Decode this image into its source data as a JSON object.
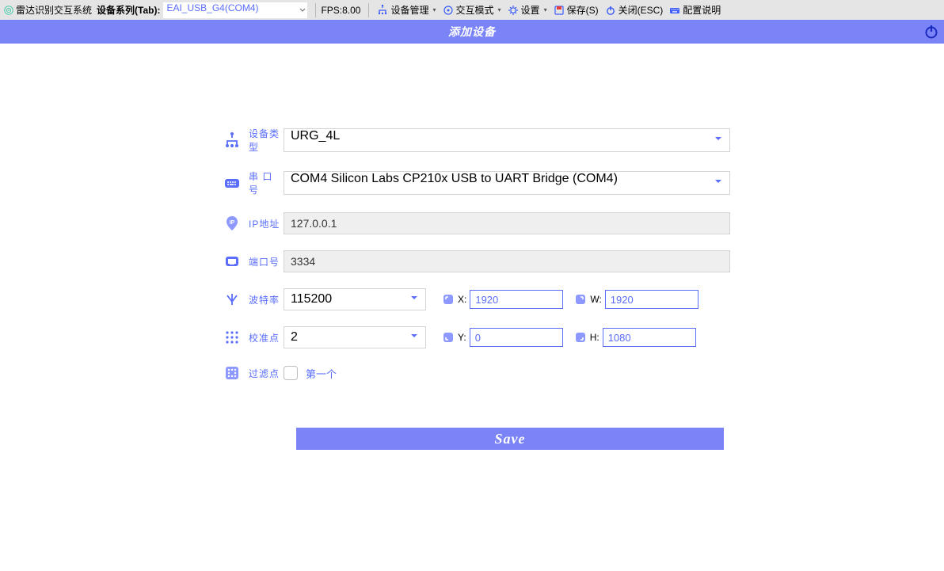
{
  "toolbar": {
    "brand": "雷达识别交互系统",
    "device_series_label": "设备系列(Tab):",
    "device_series_value": "EAI_USB_G4(COM4)",
    "fps_label": "FPS:",
    "fps_value": "8.00",
    "device_mgmt": "设备管理",
    "interaction_mode": "交互模式",
    "settings": "设置",
    "save": "保存(S)",
    "close": "关闭(ESC)",
    "config_help": "配置说明"
  },
  "titlebar": {
    "title": "添加设备"
  },
  "form": {
    "device_type_label": "设备类型",
    "device_type_value": "URG_4L",
    "serial_port_label": "串 口 号",
    "serial_port_value": "COM4 Silicon Labs CP210x USB to UART Bridge (COM4)",
    "ip_label": "IP地址",
    "ip_value": "127.0.0.1",
    "port_label": "端口号",
    "port_value": "3334",
    "baud_label": "波特率",
    "baud_value": "115200",
    "cal_label": "校准点",
    "cal_value": "2",
    "filter_label": "过滤点",
    "filter_first": "第一个",
    "x_label": "X:",
    "x_value": "1920",
    "y_label": "Y:",
    "y_value": "0",
    "w_label": "W:",
    "w_value": "1920",
    "h_label": "H:",
    "h_value": "1080",
    "save_button": "Save"
  }
}
